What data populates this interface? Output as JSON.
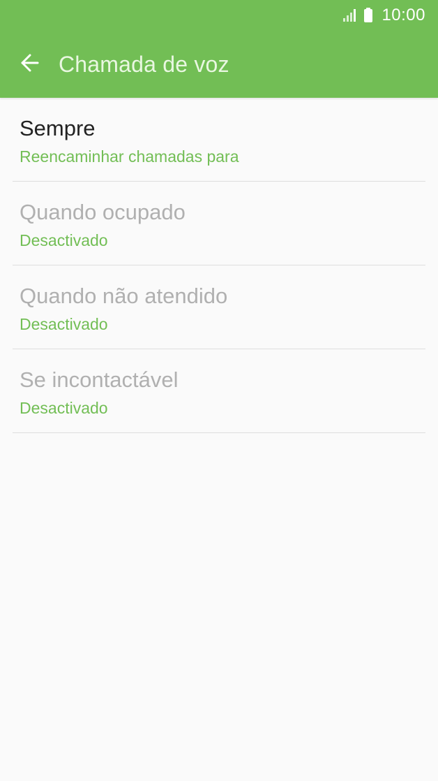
{
  "status_bar": {
    "time": "10:00",
    "signal_icon": "signal-icon",
    "battery_icon": "battery-icon"
  },
  "header": {
    "title": "Chamada de voz",
    "back_icon": "arrow-left-icon"
  },
  "items": [
    {
      "title": "Sempre",
      "subtitle": "Reencaminhar chamadas para",
      "enabled": true
    },
    {
      "title": "Quando ocupado",
      "subtitle": "Desactivado",
      "enabled": false
    },
    {
      "title": "Quando não atendido",
      "subtitle": "Desactivado",
      "enabled": false
    },
    {
      "title": "Se incontactável",
      "subtitle": "Desactivado",
      "enabled": false
    }
  ],
  "colors": {
    "accent": "#72be55",
    "background": "#fafafa",
    "title_enabled": "#222222",
    "title_disabled": "#b0b0b0",
    "divider": "#dedede"
  }
}
